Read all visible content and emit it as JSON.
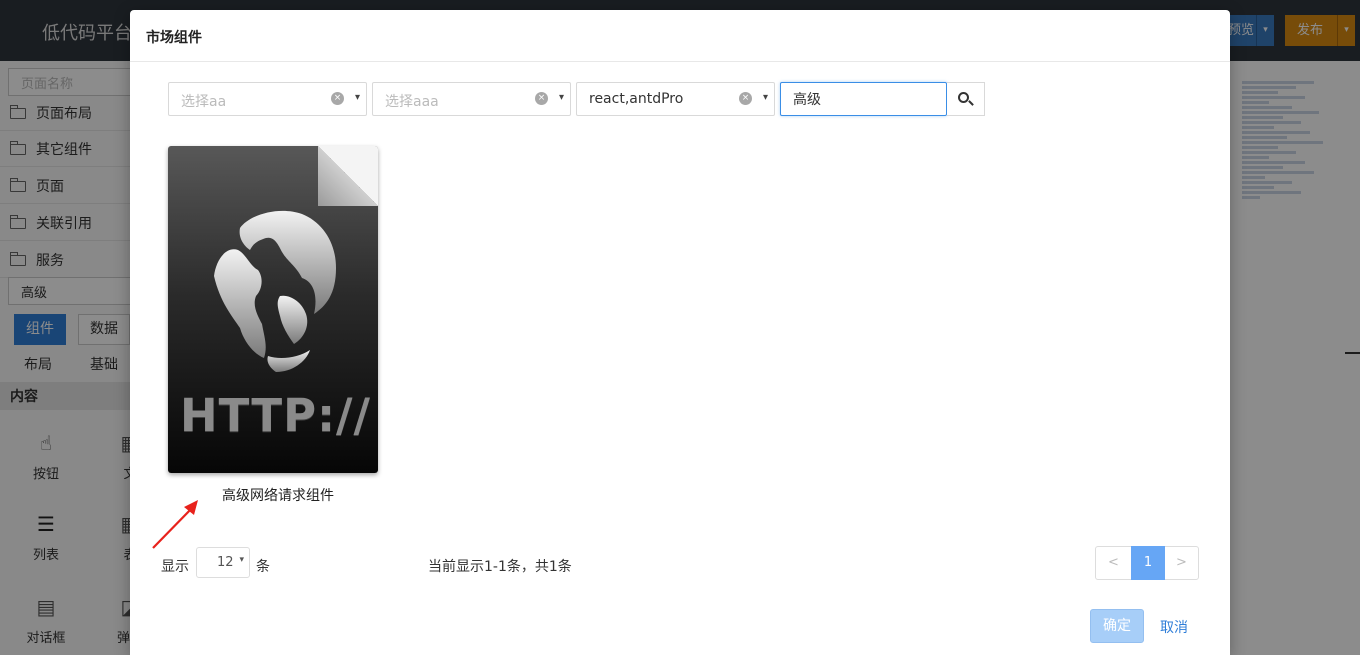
{
  "app": {
    "title": "低代码平台",
    "preview_label": "预览",
    "publish_label": "发布",
    "dropdown_caret": "▾"
  },
  "sidebar": {
    "search_placeholder": "页面名称",
    "folders": [
      "页面布局",
      "其它组件",
      "页面",
      "关联引用",
      "服务"
    ],
    "keyword": "高级",
    "tabs": [
      "组件",
      "数据"
    ],
    "sub_tabs": [
      "布局",
      "基础"
    ],
    "section": "内容",
    "widgets": [
      "按钮",
      "文",
      "列表",
      "表",
      "对话框",
      "弹出"
    ]
  },
  "modal": {
    "title": "市场组件",
    "filters": [
      {
        "text": "选择aa",
        "placeholder": true
      },
      {
        "text": "选择aaa",
        "placeholder": true
      },
      {
        "text": "react,antdPro",
        "placeholder": false
      }
    ],
    "clear_icon": "×",
    "arrow_icon": "▾",
    "search_value": "高级",
    "results": [
      {
        "label": "高级网络请求组件",
        "thumbnail_text": "HTTP://",
        "icon": "http-globe-icon"
      }
    ],
    "pagination": {
      "show_label": "显示",
      "page_size": "12",
      "unit_label": "条",
      "info": "当前显示1-1条，共1条",
      "prev": "<",
      "current": "1",
      "next": ">"
    },
    "ok_label": "确定",
    "cancel_label": "取消"
  }
}
